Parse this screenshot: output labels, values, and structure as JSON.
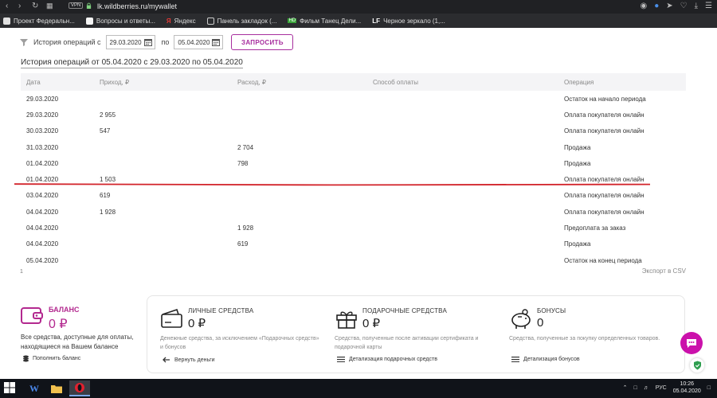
{
  "browser": {
    "vpn_label": "VPN",
    "url": "lk.wildberries.ru/mywallet",
    "bookmarks": [
      "Проект Федеральн...",
      "Вопросы и ответы...",
      "Яндекс",
      "Панель закладок (...",
      "Фильм Танец Дели...",
      "Черное зеркало (1,..."
    ],
    "bookmark_prefix_hd": "HD",
    "bookmark_prefix_lf": "LF",
    "bookmark_prefix_ya": "Я"
  },
  "filter": {
    "label": "История операций с",
    "from_date": "29.03.2020",
    "po_label": "по",
    "to_date": "05.04.2020",
    "request_button": "ЗАПРОСИТЬ"
  },
  "history_title": "История операций от 05.04.2020 с 29.03.2020 по 05.04.2020",
  "table": {
    "headers": [
      "Дата",
      "Приход, ₽",
      "Расход, ₽",
      "Способ оплаты",
      "Операция"
    ],
    "rows": [
      [
        "29.03.2020",
        "",
        "",
        "",
        "Остаток на начало периода"
      ],
      [
        "29.03.2020",
        "2 955",
        "",
        "",
        "Оплата покупателя онлайн"
      ],
      [
        "30.03.2020",
        "547",
        "",
        "",
        "Оплата покупателя онлайн"
      ],
      [
        "31.03.2020",
        "",
        "2 704",
        "",
        "Продажа"
      ],
      [
        "01.04.2020",
        "",
        "798",
        "",
        "Продажа"
      ],
      [
        "01.04.2020",
        "1 503",
        "",
        "",
        "Оплата покупателя онлайн"
      ],
      [
        "03.04.2020",
        "619",
        "",
        "",
        "Оплата покупателя онлайн"
      ],
      [
        "04.04.2020",
        "1 928",
        "",
        "",
        "Оплата покупателя онлайн"
      ],
      [
        "04.04.2020",
        "",
        "1 928",
        "",
        "Предоплата за заказ"
      ],
      [
        "04.04.2020",
        "",
        "619",
        "",
        "Продажа"
      ],
      [
        "05.04.2020",
        "",
        "",
        "",
        "Остаток на конец периода"
      ]
    ]
  },
  "pager": "1",
  "export_label": "Экспорт в CSV",
  "balance": {
    "label": "БАЛАНС",
    "amount": "0 ₽",
    "desc": "Все средства, доступные для оплаты, находящиеся на Вашем балансе",
    "link": "Пополнить баланс"
  },
  "funds": [
    {
      "label": "ЛИЧНЫЕ СРЕДСТВА",
      "amount": "0 ₽",
      "desc": "Денежные средства, за исключением «Подарочных средств» и бонусов",
      "link": "Вернуть деньги"
    },
    {
      "label": "ПОДАРОЧНЫЕ СРЕДСТВА",
      "amount": "0 ₽",
      "desc": "Средства, полученные после активации сертификата и подарочной карты",
      "link": "Детализация подарочных средств"
    },
    {
      "label": "БОНУСЫ",
      "amount": "0",
      "desc": "Средства, полученные за покупку определенных товаров.",
      "link": "Детализация бонусов"
    }
  ],
  "taskbar": {
    "word_letter": "W",
    "lang": "РУС",
    "time": "10:26",
    "date": "05.04.2020"
  },
  "colors": {
    "brand": "#b3298f",
    "button_border": "#a72e9e",
    "chat_bubble": "#cb11ab",
    "red_underline": "#d2232a"
  }
}
